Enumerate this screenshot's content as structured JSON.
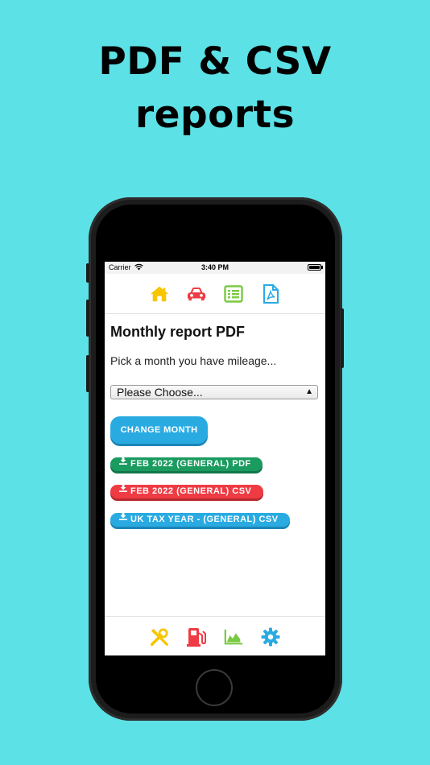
{
  "headline": {
    "line1": "PDF & CSV",
    "line2": "reports"
  },
  "status_bar": {
    "carrier": "Carrier",
    "time": "3:40 PM"
  },
  "top_nav": {
    "items": [
      {
        "icon": "home-icon",
        "color": "#f7c600"
      },
      {
        "icon": "car-icon",
        "color": "#ef3b43"
      },
      {
        "icon": "list-icon",
        "color": "#7ac943"
      },
      {
        "icon": "pdf-file-icon",
        "color": "#29abe2"
      }
    ]
  },
  "main": {
    "title": "Monthly report PDF",
    "subtitle": "Pick a month you have mileage...",
    "month_select": {
      "selected": "Please Choose..."
    },
    "change_month_label": "CHANGE MONTH",
    "downloads": {
      "pdf_label": "FEB 2022 (GENERAL) PDF",
      "csv_label": "FEB 2022 (GENERAL) CSV",
      "tax_label": "UK TAX YEAR - (GENERAL) CSV"
    }
  },
  "bottom_nav": {
    "items": [
      {
        "icon": "tools-icon",
        "color": "#f7c600"
      },
      {
        "icon": "fuel-pump-icon",
        "color": "#ef3b43"
      },
      {
        "icon": "area-chart-icon",
        "color": "#7ac943"
      },
      {
        "icon": "gear-icon",
        "color": "#29abe2"
      }
    ]
  },
  "colors": {
    "background": "#5ce1e6",
    "brand_blue": "#29abe2",
    "brand_green": "#1a9b5f",
    "brand_red": "#ef3b43"
  }
}
